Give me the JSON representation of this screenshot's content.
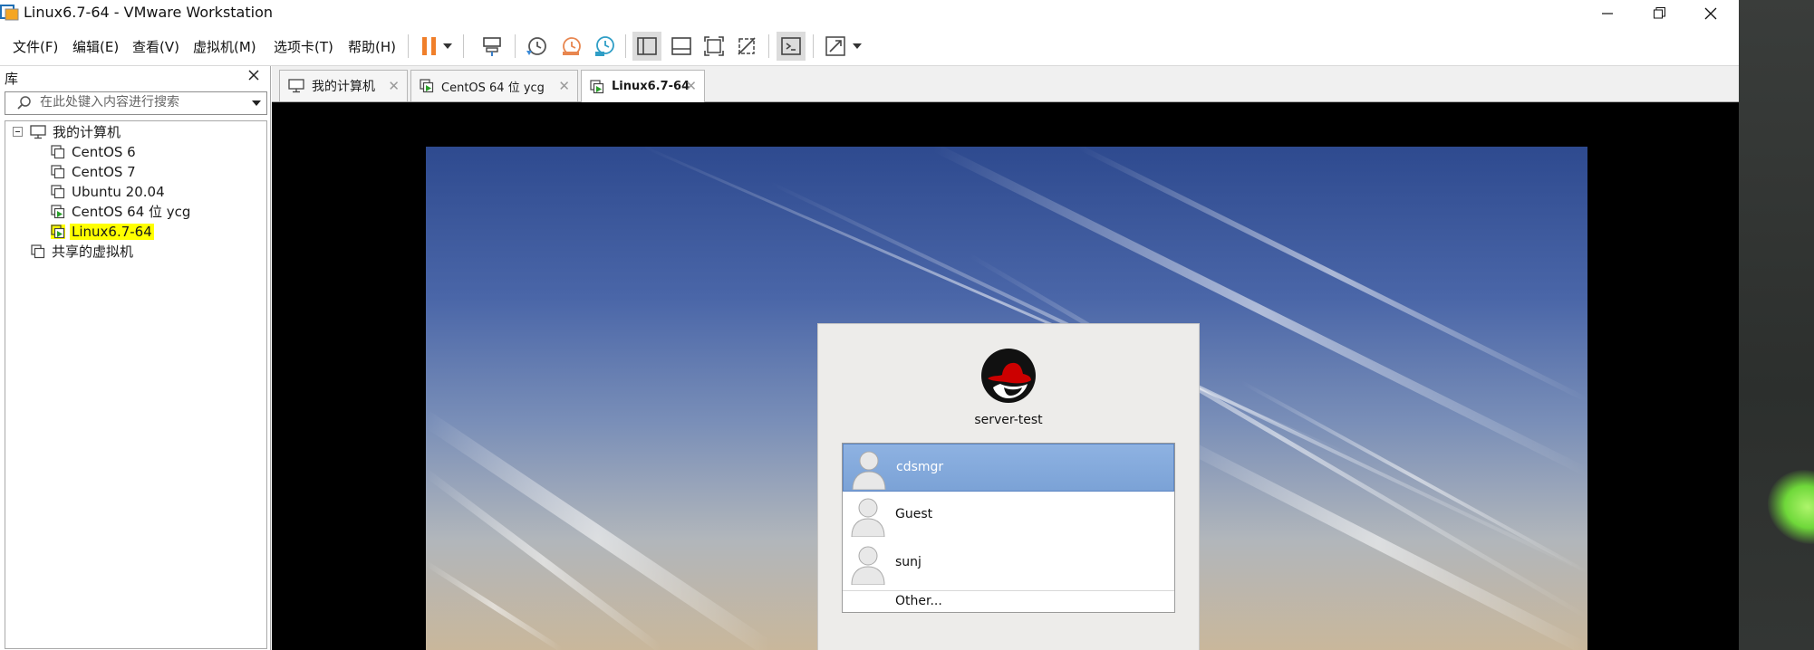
{
  "window": {
    "title": "Linux6.7-64 - VMware Workstation"
  },
  "menu": [
    "文件(F)",
    "编辑(E)",
    "查看(V)",
    "虚拟机(M)",
    "选项卡(T)",
    "帮助(H)"
  ],
  "library": {
    "title": "库",
    "search_placeholder": "在此处键入内容进行搜索",
    "tree": {
      "root": "我的计算机",
      "vms": [
        "CentOS 6",
        "CentOS 7",
        "Ubuntu 20.04",
        "CentOS 64 位 ycg",
        "Linux6.7-64"
      ],
      "selected": "Linux6.7-64",
      "shared": "共享的虚拟机"
    }
  },
  "tabs": [
    {
      "label": "我的计算机",
      "active": false
    },
    {
      "label": "CentOS 64 位 ycg",
      "active": false
    },
    {
      "label": "Linux6.7-64",
      "active": true
    }
  ],
  "guest": {
    "hostname": "server-test",
    "users": [
      "cdsmgr",
      "Guest",
      "sunj"
    ],
    "selected_user": "cdsmgr",
    "other_label": "Other..."
  },
  "colors": {
    "selection_highlight": "#ffff00",
    "selected_user_bg": "#7ba2d6",
    "pause_icon": "#f07f2a"
  }
}
